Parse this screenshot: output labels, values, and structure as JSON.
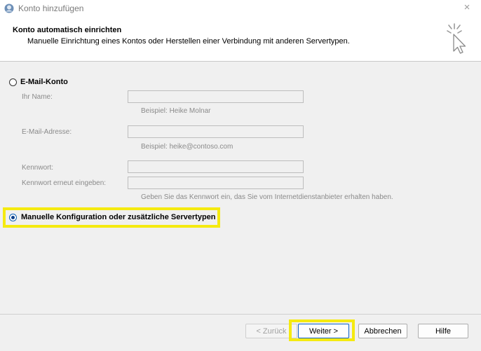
{
  "window": {
    "title": "Konto hinzufügen",
    "close_label": "×"
  },
  "header": {
    "title": "Konto automatisch einrichten",
    "subtitle": "Manuelle Einrichtung eines Kontos oder Herstellen einer Verbindung mit anderen Servertypen."
  },
  "email_account": {
    "option_label": "E-Mail-Konto",
    "selected": false,
    "name_label": "Ihr Name:",
    "name_value": "",
    "name_hint": "Beispiel: Heike Molnar",
    "email_label": "E-Mail-Adresse:",
    "email_value": "",
    "email_hint": "Beispiel: heike@contoso.com",
    "password_label": "Kennwort:",
    "password_value": "",
    "password_repeat_label": "Kennwort erneut eingeben:",
    "password_repeat_value": "",
    "password_hint": "Geben Sie das Kennwort ein, das Sie vom Internetdienstanbieter erhalten haben."
  },
  "manual_config": {
    "option_label": "Manuelle Konfiguration oder zusätzliche Servertypen",
    "selected": true
  },
  "buttons": {
    "back": "< Zurück",
    "next": "Weiter >",
    "cancel": "Abbrechen",
    "help": "Hilfe"
  },
  "icons": {
    "app": "outlook-account-icon",
    "wizard": "click-cursor-icon",
    "close": "close-icon"
  },
  "colors": {
    "highlight": "#f5ea10",
    "radio_selected": "#0a3f8a"
  }
}
